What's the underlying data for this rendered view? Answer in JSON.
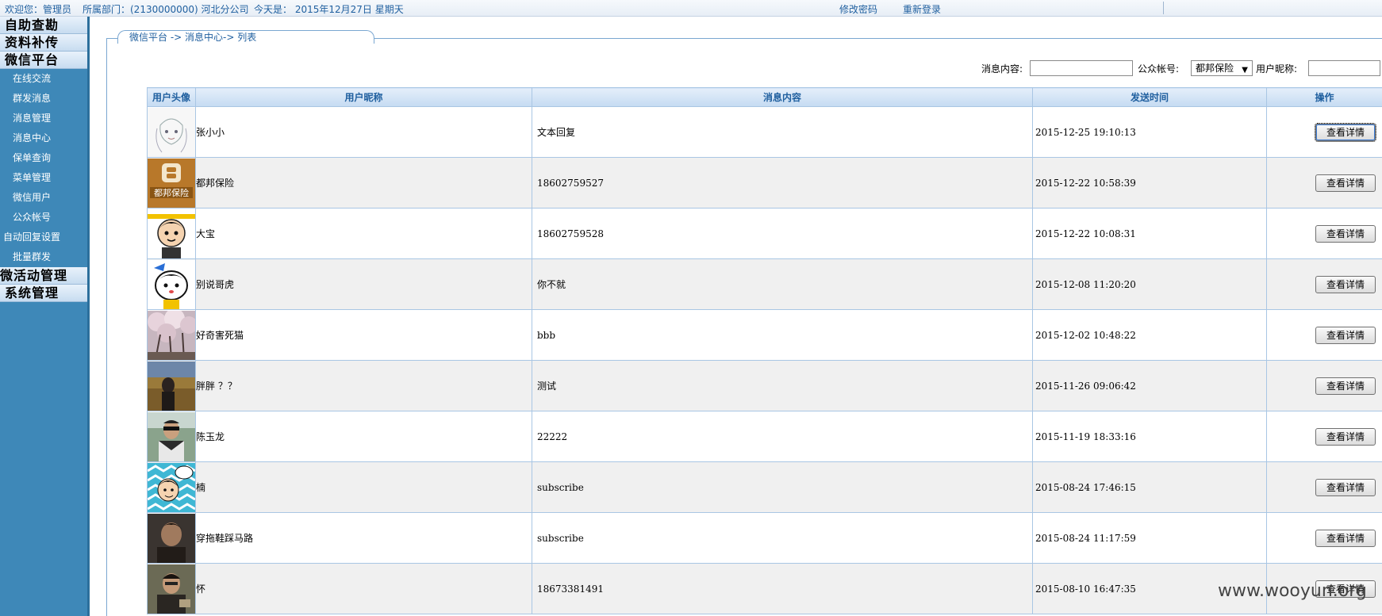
{
  "topbar": {
    "welcome": "欢迎您：管理员",
    "department": "所属部门：(2130000000) 河北分公司",
    "today": "今天是：  2015年12月27日  星期天",
    "change_password": "修改密码",
    "relogin": "重新登录"
  },
  "sidebar": {
    "sections": [
      {
        "label": "自助查勘"
      },
      {
        "label": "资料补传"
      },
      {
        "label": "微信平台"
      }
    ],
    "items": [
      {
        "label": "在线交流"
      },
      {
        "label": "群发消息"
      },
      {
        "label": "消息管理"
      },
      {
        "label": "消息中心"
      },
      {
        "label": "保单查询"
      },
      {
        "label": "菜单管理"
      },
      {
        "label": "微信用户"
      },
      {
        "label": "公众帐号"
      },
      {
        "label": "自动回复设置"
      },
      {
        "label": "批量群发"
      }
    ],
    "bottom_sections": [
      {
        "label": "微活动管理"
      },
      {
        "label": "系统管理"
      }
    ]
  },
  "breadcrumb": "微信平台 -> 消息中心-> 列表",
  "search": {
    "content_label": "消息内容:",
    "content_value": "",
    "account_label": "公众帐号:",
    "account_selected": "都邦保险",
    "nickname_label": "用户昵称:",
    "nickname_value": ""
  },
  "table": {
    "headers": [
      "用户头像",
      "用户昵称",
      "消息内容",
      "发送时间",
      "操作"
    ],
    "rows": [
      {
        "nickname": "张小小",
        "message": "文本回复",
        "time": "2015-12-25 19:10:13",
        "action": "查看详情",
        "avatar": "sketch-girl"
      },
      {
        "nickname": "都邦保险",
        "message": "18602759527",
        "time": "2015-12-22 10:58:39",
        "action": "查看详情",
        "avatar": "dubang-logo"
      },
      {
        "nickname": "大宝",
        "message": "18602759528",
        "time": "2015-12-22 10:08:31",
        "action": "查看详情",
        "avatar": "cartoon-boy"
      },
      {
        "nickname": "别说哥虎",
        "message": "你不就",
        "time": "2015-12-08 11:20:20",
        "action": "查看详情",
        "avatar": "cartoon-face"
      },
      {
        "nickname": "好奇害死猫",
        "message": "bbb",
        "time": "2015-12-02 10:48:22",
        "action": "查看详情",
        "avatar": "cherry-blossom"
      },
      {
        "nickname": "胖胖 ？？",
        "message": "测试",
        "time": "2015-11-26 09:06:42",
        "action": "查看详情",
        "avatar": "field-photo"
      },
      {
        "nickname": "陈玉龙",
        "message": "22222",
        "time": "2015-11-19 18:33:16",
        "action": "查看详情",
        "avatar": "man-sunglasses"
      },
      {
        "nickname": "楠",
        "message": "subscribe",
        "time": "2015-08-24 17:46:15",
        "action": "查看详情",
        "avatar": "cartoon-zigzag"
      },
      {
        "nickname": "穿拖鞋踩马路",
        "message": "subscribe",
        "time": "2015-08-24 11:17:59",
        "action": "查看详情",
        "avatar": "dark-photo"
      },
      {
        "nickname": "怀",
        "message": "18673381491",
        "time": "2015-08-10 16:47:35",
        "action": "查看详情",
        "avatar": "man-photo"
      }
    ]
  },
  "watermark": "www.wooyun.org",
  "colors": {
    "sidebar_bg": "#3e88b8",
    "header_text": "#1f5f9f",
    "grid_line": "#a9c6e4",
    "row_alt": "#f0f0f0"
  }
}
